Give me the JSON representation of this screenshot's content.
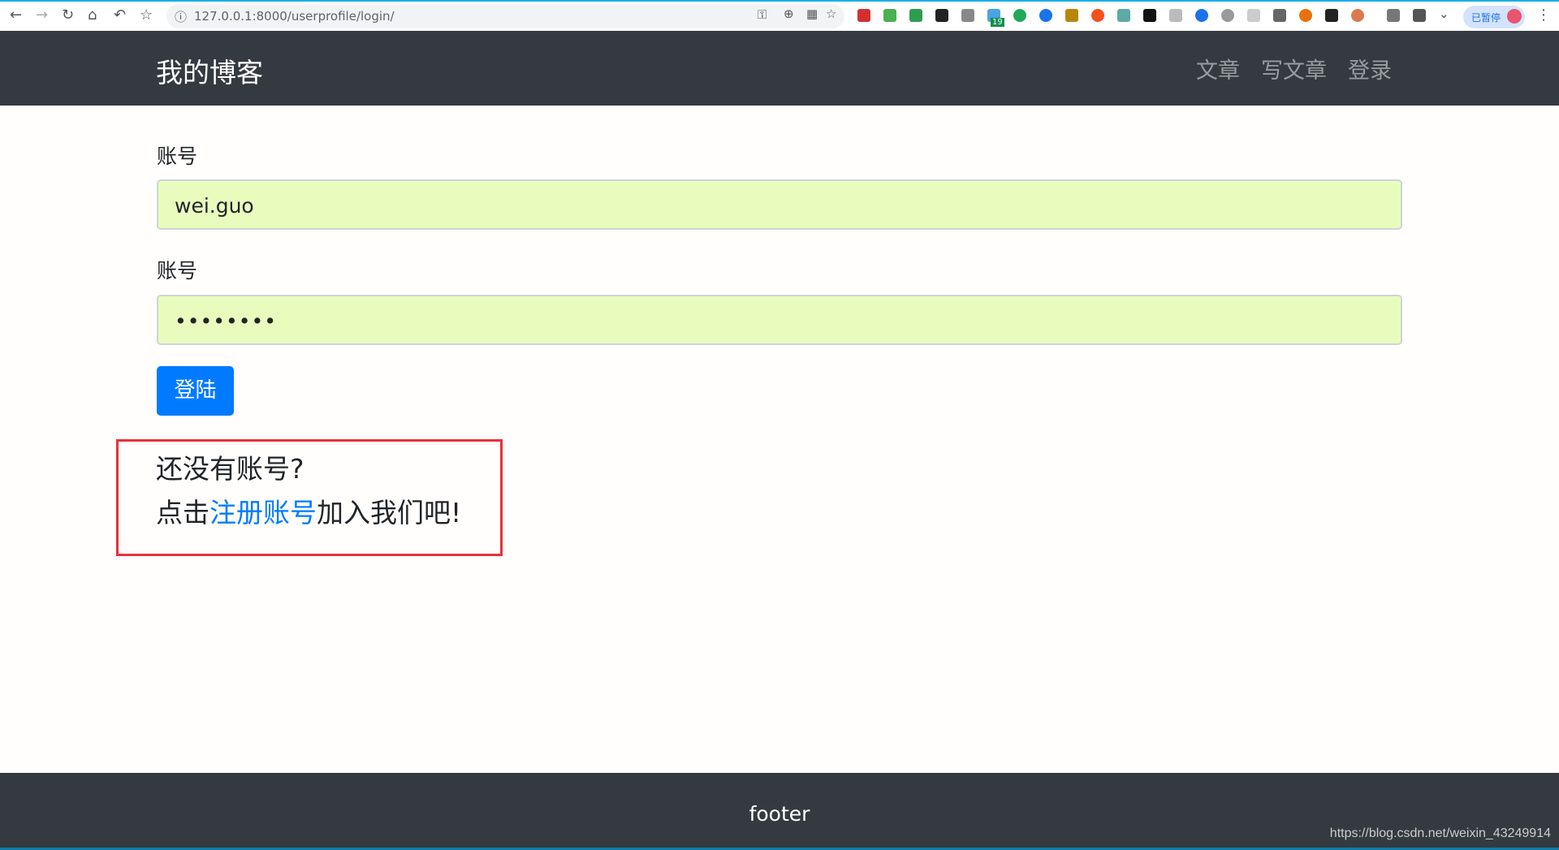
{
  "browser": {
    "url": "127.0.0.1:8000/userprofile/login/",
    "paused_label": "已暂停",
    "extension_badge": "19"
  },
  "navbar": {
    "brand": "我的博客",
    "links": [
      "文章",
      "写文章",
      "登录"
    ]
  },
  "form": {
    "username_label": "账号",
    "username_value": "wei.guo",
    "password_label": "账号",
    "password_value": "••••••••",
    "submit_label": "登陆"
  },
  "hint": {
    "line1": "还没有账号?",
    "prefix": "点击",
    "link": "注册账号",
    "suffix": "加入我们吧!"
  },
  "footer": {
    "text": "footer",
    "watermark": "https://blog.csdn.net/weixin_43249914"
  },
  "colors": {
    "navbar": "#343a40",
    "primary": "#007bff",
    "autofill": "#e8fdbd",
    "highlight_box": "#e8313b"
  }
}
